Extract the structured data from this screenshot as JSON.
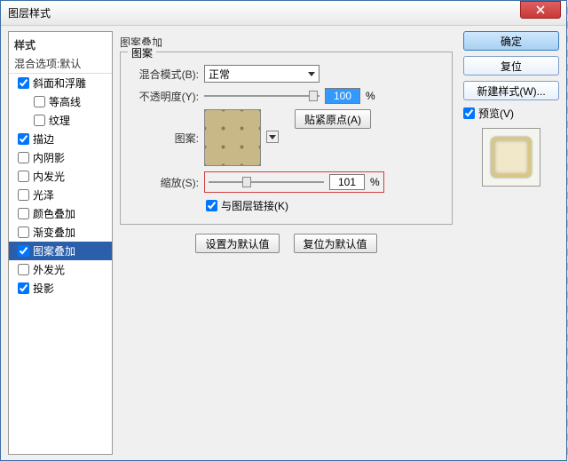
{
  "window": {
    "title": "图层样式"
  },
  "left": {
    "header": "样式",
    "blend_defaults": "混合选项:默认",
    "items": [
      {
        "label": "斜面和浮雕",
        "checked": true,
        "indent": false
      },
      {
        "label": "等高线",
        "checked": false,
        "indent": true
      },
      {
        "label": "纹理",
        "checked": false,
        "indent": true
      },
      {
        "label": "描边",
        "checked": true,
        "indent": false
      },
      {
        "label": "内阴影",
        "checked": false,
        "indent": false
      },
      {
        "label": "内发光",
        "checked": false,
        "indent": false
      },
      {
        "label": "光泽",
        "checked": false,
        "indent": false
      },
      {
        "label": "颜色叠加",
        "checked": false,
        "indent": false
      },
      {
        "label": "渐变叠加",
        "checked": false,
        "indent": false
      },
      {
        "label": "图案叠加",
        "checked": true,
        "indent": false,
        "selected": true
      },
      {
        "label": "外发光",
        "checked": false,
        "indent": false
      },
      {
        "label": "投影",
        "checked": true,
        "indent": false
      }
    ]
  },
  "center": {
    "title": "图案叠加",
    "legend": "图案",
    "blend_mode_label": "混合模式(B):",
    "blend_mode_value": "正常",
    "opacity_label": "不透明度(Y):",
    "opacity_value": "100",
    "pattern_label": "图案:",
    "snap_origin": "贴紧原点(A)",
    "scale_label": "缩放(S):",
    "scale_value": "101",
    "percent": "%",
    "link_label": "与图层链接(K)",
    "link_checked": true,
    "set_default": "设置为默认值",
    "reset_default": "复位为默认值"
  },
  "right": {
    "ok": "确定",
    "cancel": "复位",
    "new_style": "新建样式(W)...",
    "preview_label": "预览(V)",
    "preview_checked": true
  }
}
